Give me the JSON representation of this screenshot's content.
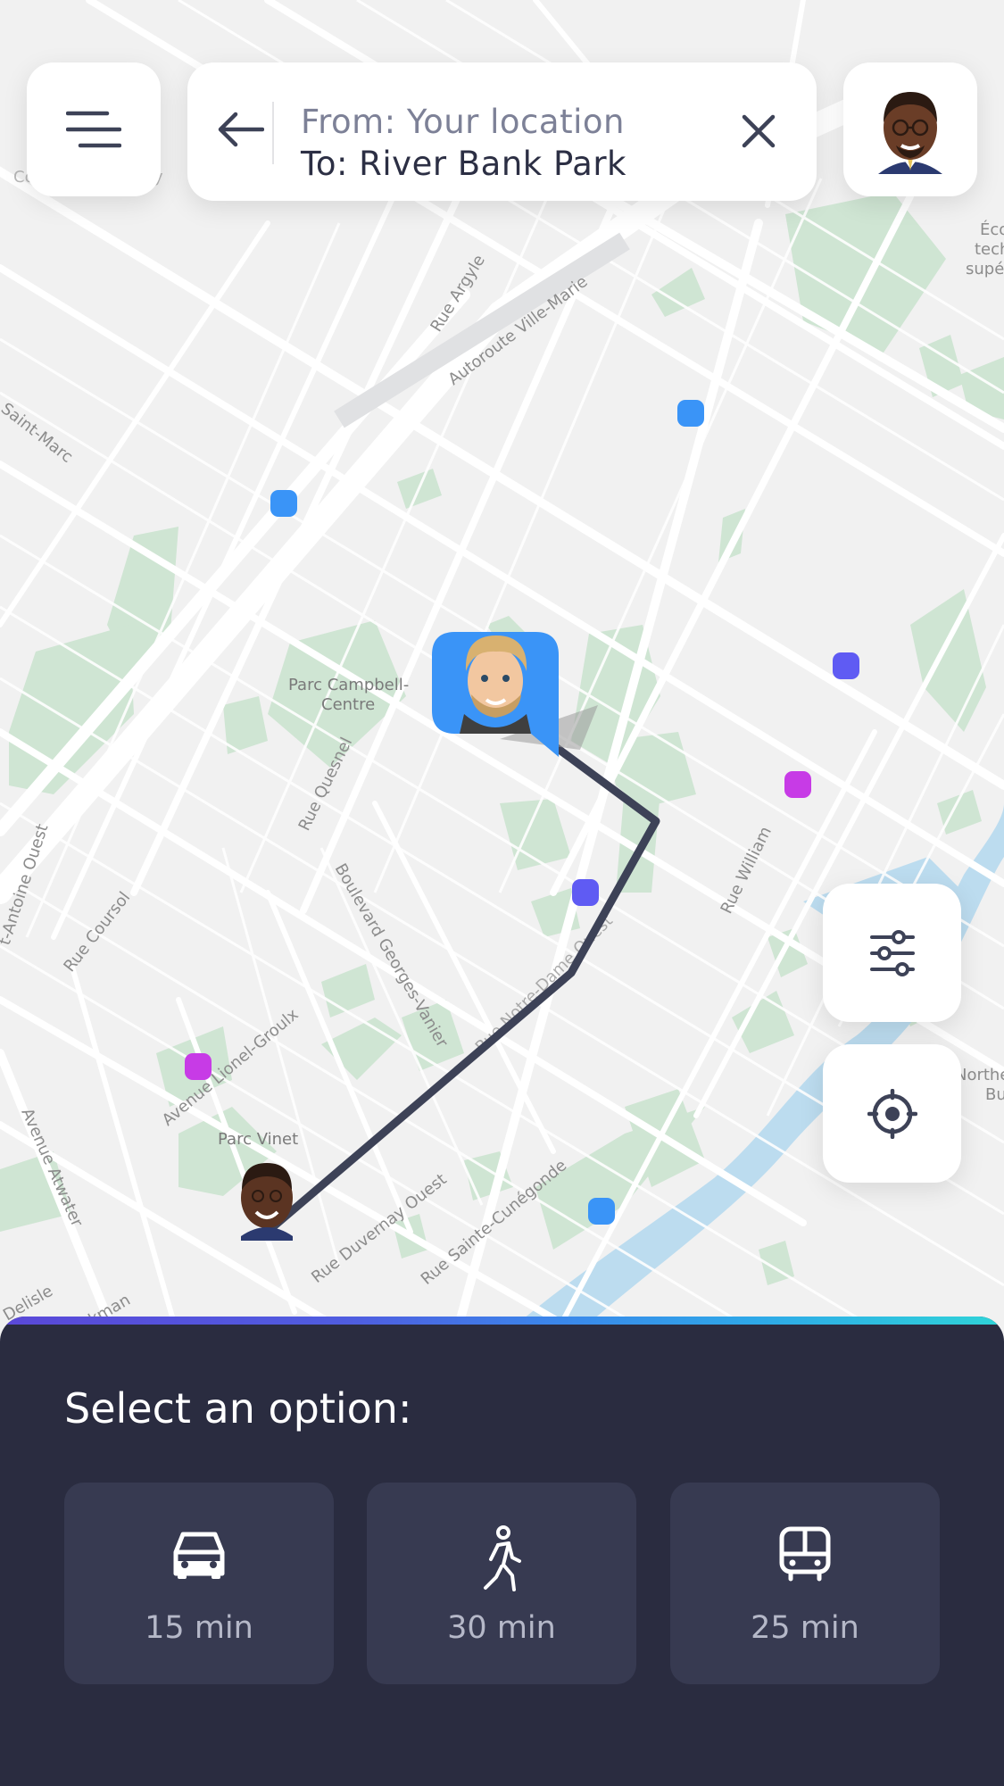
{
  "search": {
    "from": "From: Your location",
    "to": "To: River Bank Park"
  },
  "map": {
    "street_labels": [
      "Rue Argyle",
      "Autoroute Ville-Marie",
      "Saint-Marc",
      "Rue Quesnel",
      "Boulevard Georges-Vanier",
      "Rue William",
      "Rue Coursol",
      "Avenue Lionel-Groulx",
      "Avenue Atwater",
      "Rue Duvernay Ouest",
      "Rue Sainte-Cunégonde",
      "t-Antoine Ouest",
      "Rue Notre-Dame Ouest",
      "Delisle",
      "ckman"
    ],
    "park_labels": [
      "Parc Campbell-",
      "Centre",
      "Parc Vinet"
    ],
    "edge_labels": [
      "Éco",
      "techn",
      "supérie",
      "Northe",
      "Bu",
      "Co",
      "ity"
    ],
    "marker_colors": {
      "blue": "#3a94f7",
      "indigo": "#5f5bf3",
      "magenta": "#c73be6"
    },
    "route_color": "#3d4257"
  },
  "controls": {
    "menu_icon": "menu-icon",
    "back_icon": "arrow-left-icon",
    "clear_icon": "close-icon",
    "filter_icon": "sliders-icon",
    "locate_icon": "crosshair-icon"
  },
  "sheet": {
    "title": "Select an option:",
    "options": [
      {
        "icon": "car-icon",
        "label": "15 min"
      },
      {
        "icon": "walking-icon",
        "label": "30 min"
      },
      {
        "icon": "bus-icon",
        "label": "25 min"
      }
    ]
  },
  "colors": {
    "sheet_bg": "#2a2c40",
    "option_bg": "#373a51",
    "accent_gradient": [
      "#5a48d8",
      "#3b86ea",
      "#2fd4d8"
    ]
  }
}
